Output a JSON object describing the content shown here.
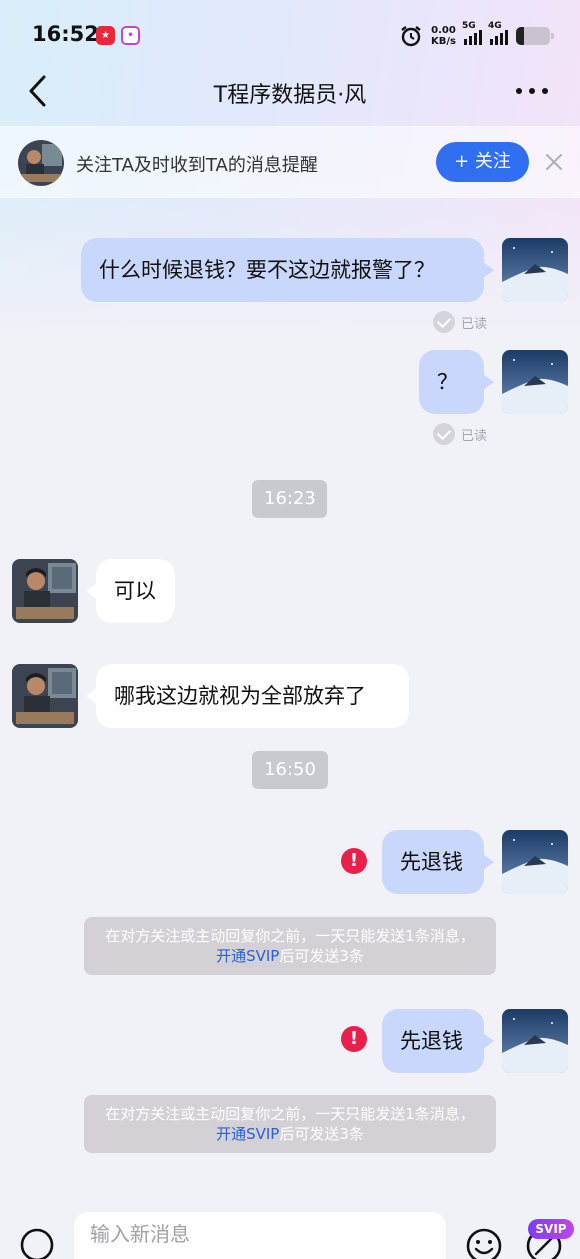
{
  "status_bar": {
    "time": "16:52",
    "net_speed_value": "0.00",
    "net_speed_unit": "KB/s",
    "sim1_label": "5G",
    "sim2_label": "4G",
    "battery_level": 0.22
  },
  "header": {
    "title": "T程序数据员·风"
  },
  "follow_prompt": {
    "text": "关注TA及时收到TA的消息提醒",
    "button_label": "+ 关注"
  },
  "messages": [
    {
      "side": "out",
      "text": "什么时候退钱？要不这边就报警了？",
      "status": "已读"
    },
    {
      "side": "out",
      "text": "？",
      "status": "已读"
    },
    {
      "type": "time",
      "text": "16:23"
    },
    {
      "side": "in",
      "text": "可以"
    },
    {
      "side": "in",
      "text": "哪我这边就视为全部放弃了"
    },
    {
      "type": "time",
      "text": "16:50"
    },
    {
      "side": "out",
      "text": "先退钱",
      "failed": true
    },
    {
      "type": "notice",
      "text_before": "在对方关注或主动回复你之前，一天只能发送1条消息，",
      "link": "开通SVIP",
      "text_after": "后可发送3条"
    },
    {
      "side": "out",
      "text": "先退钱",
      "failed": true
    },
    {
      "type": "notice",
      "text_before": "在对方关注或主动回复你之前，一天只能发送1条消息，",
      "link": "开通SVIP",
      "text_after": "后可发送3条"
    }
  ],
  "input_bar": {
    "placeholder": "输入新消息",
    "svip_badge": "SVIP"
  },
  "colors": {
    "accent": "#2f6ff0",
    "outgoing_bubble": "#c9d7fc",
    "error": "#e8204a"
  }
}
